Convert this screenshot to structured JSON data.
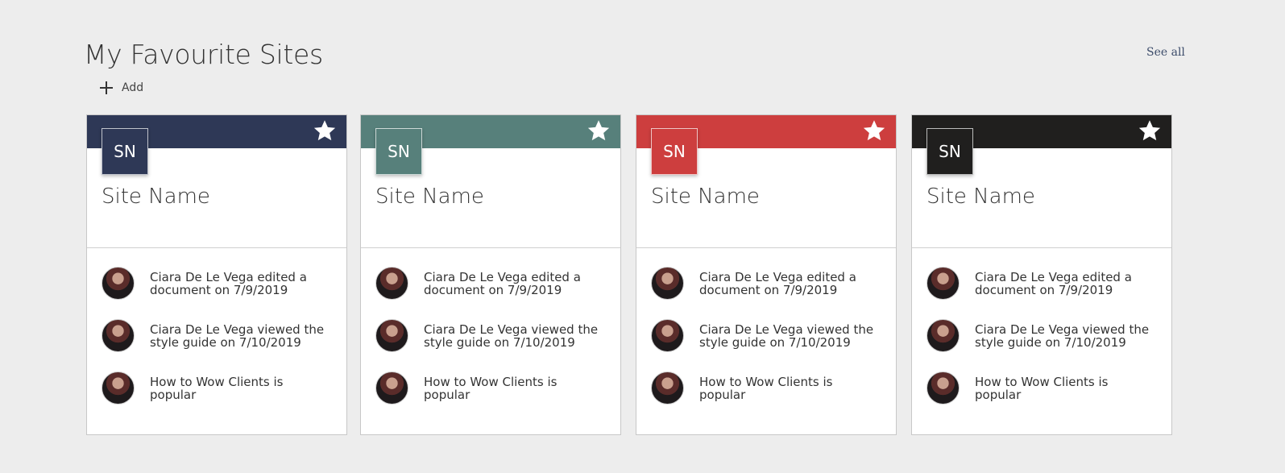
{
  "header": {
    "title": "My Favourite Sites",
    "see_all_label": "See all",
    "add_label": "Add"
  },
  "cards": [
    {
      "color": "#2e3856",
      "initials": "SN",
      "site_name": "Site Name",
      "activities": [
        {
          "text": "Ciara De Le Vega edited a document on 7/9/2019"
        },
        {
          "text": "Ciara De Le Vega viewed the style guide on 7/10/2019"
        },
        {
          "text": "How to Wow Clients is popular"
        }
      ]
    },
    {
      "color": "#57807b",
      "initials": "SN",
      "site_name": "Site Name",
      "activities": [
        {
          "text": "Ciara De Le Vega edited a document on 7/9/2019"
        },
        {
          "text": "Ciara De Le Vega viewed the style guide on 7/10/2019"
        },
        {
          "text": "How to Wow Clients is popular"
        }
      ]
    },
    {
      "color": "#cd3e3e",
      "initials": "SN",
      "site_name": "Site Name",
      "activities": [
        {
          "text": "Ciara De Le Vega edited a document on 7/9/2019"
        },
        {
          "text": "Ciara De Le Vega viewed the style guide on 7/10/2019"
        },
        {
          "text": "How to Wow Clients is popular"
        }
      ]
    },
    {
      "color": "#201f1e",
      "initials": "SN",
      "site_name": "Site Name",
      "activities": [
        {
          "text": "Ciara De Le Vega edited a document on 7/9/2019"
        },
        {
          "text": "Ciara De Le Vega viewed the style guide on 7/10/2019"
        },
        {
          "text": "How to Wow Clients is popular"
        }
      ]
    }
  ],
  "icons": {
    "add": "plus-icon",
    "favourite": "star-icon",
    "avatar": "user-avatar"
  }
}
